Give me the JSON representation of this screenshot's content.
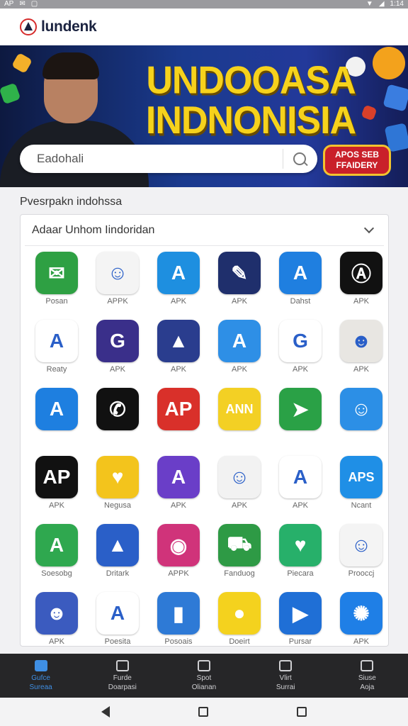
{
  "status_bar": {
    "left": "AP",
    "time": "1:14"
  },
  "header": {
    "logo_text": "lundenk"
  },
  "banner": {
    "title_line1": "UNDOOASA",
    "title_line2": "INDNONISIA",
    "search_placeholder": "Eadohali",
    "promo_line1": "APOS SEB",
    "promo_line2": "FFAIDERY"
  },
  "section_title": "Pvesrpakn indohssa",
  "card": {
    "dropdown_label": "Adaar Unhom Iindoridan"
  },
  "apps": [
    {
      "label": "Posan",
      "icon": "envelope-icon",
      "bg": "#2ea043",
      "glyph": "✉"
    },
    {
      "label": "APPK",
      "icon": "robot-mascot-icon",
      "bg": "#f4f4f4",
      "glyph": "☺"
    },
    {
      "label": "APK",
      "icon": "arrow-a-icon",
      "bg": "#1e8fe0",
      "glyph": "A"
    },
    {
      "label": "APK",
      "icon": "red-pen-icon",
      "bg": "#1f2f6c",
      "glyph": "✎"
    },
    {
      "label": "Dahst",
      "icon": "red-logo-icon",
      "bg": "#1f7fe0",
      "glyph": "A"
    },
    {
      "label": "APK",
      "icon": "anarchy-a-icon",
      "bg": "#111111",
      "glyph": "Ⓐ"
    },
    {
      "label": "Reaty",
      "icon": "letter-a-icon",
      "bg": "#ffffff",
      "glyph": "A"
    },
    {
      "label": "APK",
      "icon": "g-logo-icon",
      "bg": "#3a2f8a",
      "glyph": "G"
    },
    {
      "label": "APK",
      "icon": "play-triangle-icon",
      "bg": "#2a3d8e",
      "glyph": "▲"
    },
    {
      "label": "APK",
      "icon": "a-badge-icon",
      "bg": "#2e8fe6",
      "glyph": "A"
    },
    {
      "label": "APK",
      "icon": "green-g-icon",
      "bg": "#ffffff",
      "glyph": "G"
    },
    {
      "label": "APK",
      "icon": "person-photo-icon",
      "bg": "#e8e6e2",
      "glyph": "☻"
    },
    {
      "label": "",
      "icon": "blue-triangle-icon",
      "bg": "#1e7fe0",
      "glyph": "A"
    },
    {
      "label": "",
      "icon": "phone-icon",
      "bg": "#111111",
      "glyph": "✆"
    },
    {
      "label": "",
      "icon": "ap-red-icon",
      "bg": "#d9302a",
      "glyph": "AP"
    },
    {
      "label": "",
      "icon": "ann-badge-icon",
      "bg": "#f3d024",
      "glyph": "ANN"
    },
    {
      "label": "",
      "icon": "green-arrow-icon",
      "bg": "#2aa146",
      "glyph": "➤"
    },
    {
      "label": "",
      "icon": "faces-icon",
      "bg": "#2c8fe6",
      "glyph": "☺"
    },
    {
      "label": "APK",
      "icon": "ap-burst-icon",
      "bg": "#111111",
      "glyph": "AP"
    },
    {
      "label": "Negusa",
      "icon": "heart-icon",
      "bg": "#f3c41c",
      "glyph": "♥"
    },
    {
      "label": "APK",
      "icon": "purple-a-icon",
      "bg": "#6a3ec8",
      "glyph": "A"
    },
    {
      "label": "APK",
      "icon": "cartoon-face-icon",
      "bg": "#f2f2f2",
      "glyph": "☺"
    },
    {
      "label": "APK",
      "icon": "blue-a-icon",
      "bg": "#ffffff",
      "glyph": "A"
    },
    {
      "label": "Ncant",
      "icon": "aps-icon",
      "bg": "#1f8fe6",
      "glyph": "APS"
    },
    {
      "label": "Soesobg",
      "icon": "green-a-icon",
      "bg": "#2fa84f",
      "glyph": "A"
    },
    {
      "label": "Dritark",
      "icon": "rainbow-triangle-icon",
      "bg": "#2a5fc8",
      "glyph": "▲"
    },
    {
      "label": "APPK",
      "icon": "chrome-like-icon",
      "bg": "#d0337a",
      "glyph": "◉"
    },
    {
      "label": "Fanduog",
      "icon": "truck-icon",
      "bg": "#2e9a45",
      "glyph": "⛟"
    },
    {
      "label": "Piecara",
      "icon": "cloud-heart-icon",
      "bg": "#27b06a",
      "glyph": "♥"
    },
    {
      "label": "Prooccj",
      "icon": "robot-mascot-icon",
      "bg": "#f4f4f4",
      "glyph": "☺"
    },
    {
      "label": "APK",
      "icon": "person-portrait-icon",
      "bg": "#3b5bbf",
      "glyph": "☻"
    },
    {
      "label": "Poesita",
      "icon": "ap-green-red-icon",
      "bg": "#ffffff",
      "glyph": "A"
    },
    {
      "label": "Posoais",
      "icon": "book-icon",
      "bg": "#2e7ad6",
      "glyph": "▮"
    },
    {
      "label": "Doeirt",
      "icon": "fruit-icon",
      "bg": "#f4d21e",
      "glyph": "●"
    },
    {
      "label": "Pursar",
      "icon": "swirl-triangle-icon",
      "bg": "#1f6fd6",
      "glyph": "▶"
    },
    {
      "label": "APK",
      "icon": "sun-burst-icon",
      "bg": "#1f7fe6",
      "glyph": "✺"
    }
  ],
  "bottom_nav": [
    {
      "line1": "Gufce",
      "line2": "Sureaa",
      "icon": "home-icon"
    },
    {
      "line1": "Furde",
      "line2": "Doarpasi",
      "icon": "list-icon"
    },
    {
      "line1": "Spot",
      "line2": "Olianan",
      "icon": "heart-shield-icon"
    },
    {
      "line1": "Vlirt",
      "line2": "Surrai",
      "icon": "clock-icon"
    },
    {
      "line1": "Siuse",
      "line2": "Aoja",
      "icon": "cloud-icon"
    }
  ]
}
